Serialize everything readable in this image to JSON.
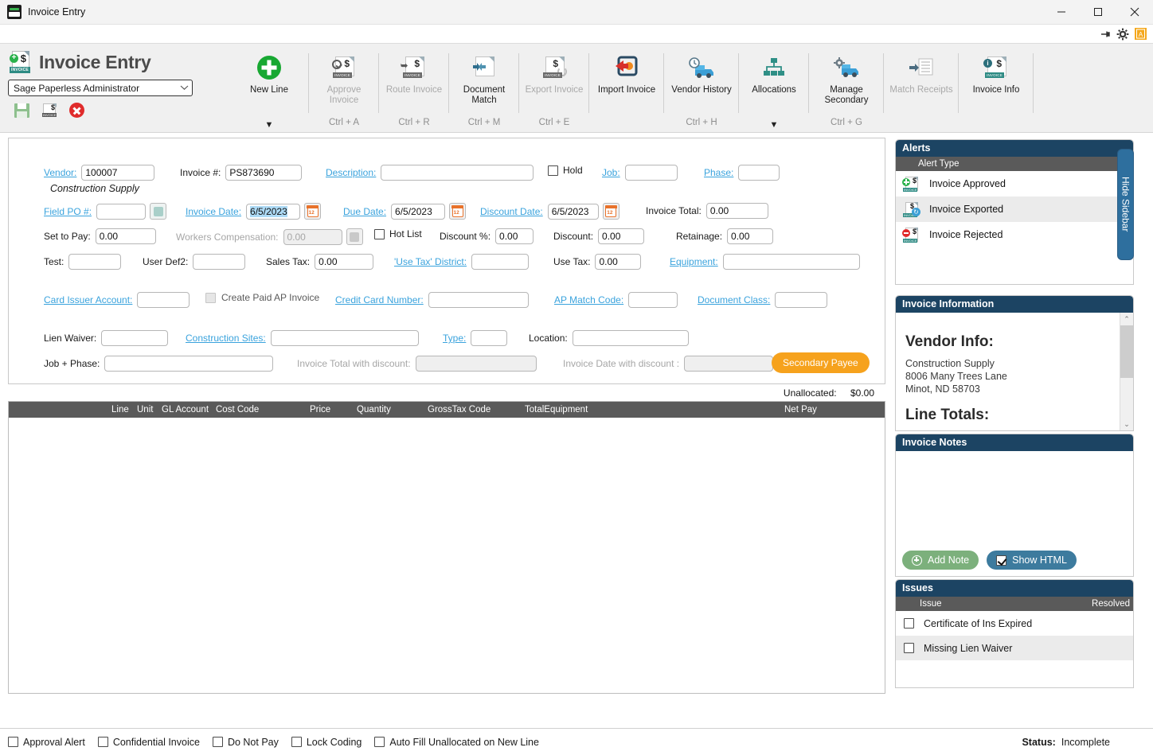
{
  "window": {
    "title": "Invoice Entry",
    "minimize_label": "—",
    "maximize_label": "☐",
    "close_label": "✕"
  },
  "mini_strip": {
    "pin_icon": "pin-icon",
    "gear_icon": "gear-icon",
    "badge_icon": "admin-badge-icon"
  },
  "brand": {
    "title": "Invoice Entry",
    "user_select_value": "Sage Paperless Administrator",
    "chevron": "⌄",
    "save_icon": "save-icon",
    "new_invoice_icon": "new-invoice-icon",
    "delete_icon": "delete-icon"
  },
  "ribbon": {
    "items": [
      {
        "label": "New Line",
        "shortcut": "",
        "arrow": "▼",
        "disabled": false,
        "icon": "plus-circle-icon"
      },
      {
        "label": "Approve\nInvoice",
        "shortcut": "Ctrl + A",
        "arrow": "",
        "disabled": true,
        "icon": "approve-invoice-icon"
      },
      {
        "label": "Route Invoice",
        "shortcut": "Ctrl + R",
        "arrow": "",
        "disabled": true,
        "icon": "route-invoice-icon"
      },
      {
        "label": "Document\nMatch",
        "shortcut": "Ctrl + M",
        "arrow": "",
        "disabled": false,
        "icon": "document-match-icon"
      },
      {
        "label": "Export Invoice",
        "shortcut": "Ctrl + E",
        "arrow": "",
        "disabled": true,
        "icon": "export-invoice-icon"
      },
      {
        "label": "Import Invoice",
        "shortcut": "",
        "arrow": "",
        "disabled": false,
        "icon": "import-invoice-icon"
      },
      {
        "label": "Vendor History",
        "shortcut": "Ctrl + H",
        "arrow": "",
        "disabled": false,
        "icon": "vendor-history-icon"
      },
      {
        "label": "Allocations",
        "shortcut": "",
        "arrow": "▼",
        "disabled": false,
        "icon": "allocations-icon"
      },
      {
        "label": "Manage\nSecondary",
        "shortcut": "Ctrl + G",
        "arrow": "",
        "disabled": false,
        "icon": "manage-secondary-icon"
      },
      {
        "label": "Match Receipts",
        "shortcut": "",
        "arrow": "",
        "disabled": true,
        "icon": "match-receipts-icon"
      },
      {
        "label": "Invoice Info",
        "shortcut": "",
        "arrow": "",
        "disabled": false,
        "icon": "invoice-info-icon"
      }
    ]
  },
  "form": {
    "vendor_label": "Vendor:",
    "vendor_value": "100007",
    "vendor_name": "Construction Supply",
    "invoice_no_label": "Invoice #:",
    "invoice_no_value": "PS873690",
    "description_label": "Description:",
    "description_value": "",
    "hold_label": "Hold",
    "job_label": "Job:",
    "job_value": "",
    "phase_label": "Phase:",
    "phase_value": "",
    "field_po_label": "Field PO #:",
    "field_po_value": "",
    "invoice_date_label": "Invoice Date:",
    "invoice_date_value": "6/5/2023",
    "due_date_label": "Due Date:",
    "due_date_value": "6/5/2023",
    "discount_date_label": "Discount Date:",
    "discount_date_value": "6/5/2023",
    "invoice_total_label": "Invoice Total:",
    "invoice_total_value": "0.00",
    "set_to_pay_label": "Set to Pay:",
    "set_to_pay_value": "0.00",
    "workers_comp_label": "Workers Compensation:",
    "workers_comp_value": "0.00",
    "hot_list_label": "Hot List",
    "discount_pct_label": "Discount %:",
    "discount_pct_value": "0.00",
    "discount_label": "Discount:",
    "discount_value": "0.00",
    "retainage_label": "Retainage:",
    "retainage_value": "0.00",
    "test_label": "Test:",
    "test_value": "",
    "user_def2_label": "User Def2:",
    "user_def2_value": "",
    "sales_tax_label": "Sales Tax:",
    "sales_tax_value": "0.00",
    "use_tax_district_label": "'Use Tax' District:",
    "use_tax_district_value": "",
    "use_tax_label": "Use Tax:",
    "use_tax_value": "0.00",
    "equipment_label": "Equipment:",
    "equipment_value": "",
    "card_issuer_label": "Card Issuer Account:",
    "card_issuer_value": "",
    "create_paid_ap_label": "Create Paid AP Invoice",
    "credit_card_label": "Credit Card Number:",
    "credit_card_value": "",
    "ap_match_label": "AP Match Code:",
    "ap_match_value": "",
    "document_class_label": "Document Class:",
    "document_class_value": "",
    "lien_waiver_label": "Lien Waiver:",
    "lien_waiver_value": "",
    "construction_sites_label": "Construction Sites:",
    "construction_sites_value": "",
    "type_label": "Type:",
    "type_value": "",
    "location_label": "Location:",
    "location_value": "",
    "job_phase_label": "Job + Phase:",
    "job_phase_value": "",
    "invoice_total_discount_label": "Invoice Total with discount:",
    "invoice_total_discount_value": "",
    "invoice_date_discount_label": "Invoice Date with discount :",
    "invoice_date_discount_value": "",
    "secondary_payee_label": "Secondary Payee"
  },
  "unallocated": {
    "label": "Unallocated:",
    "amount": "$0.00"
  },
  "grid": {
    "columns": [
      "Line",
      "Unit",
      "GL Account",
      "Cost Code",
      "Price",
      "Quantity",
      "GrossTax Code",
      "TotalEquipment",
      "Net Pay"
    ],
    "rows": []
  },
  "sidebar": {
    "hide_label": "Hide Sidebar",
    "alerts": {
      "title": "Alerts",
      "column": "Alert Type",
      "rows": [
        {
          "label": "Invoice Approved",
          "icon": "invoice-approved-icon"
        },
        {
          "label": "Invoice Exported",
          "icon": "invoice-exported-icon"
        },
        {
          "label": "Invoice Rejected",
          "icon": "invoice-rejected-icon"
        }
      ]
    },
    "invoice_information": {
      "title": "Invoice Information",
      "vendor_heading": "Vendor Info:",
      "vendor_lines": [
        "Construction Supply",
        "8006 Many Trees Lane",
        "Minot, ND 58703"
      ],
      "line_totals_heading": "Line Totals:",
      "scroll_up": "⌃",
      "scroll_down": "⌄"
    },
    "invoice_notes": {
      "title": "Invoice Notes",
      "body_text": "",
      "add_note_label": "Add Note",
      "show_html_label": "Show HTML",
      "show_html_checked": true
    },
    "issues": {
      "title": "Issues",
      "col_issue": "Issue",
      "col_resolved": "Resolved",
      "rows": [
        {
          "label": "Certificate of Ins Expired",
          "resolved": false
        },
        {
          "label": "Missing Lien Waiver",
          "resolved": false
        }
      ]
    }
  },
  "statusbar": {
    "checkboxes": [
      {
        "label": "Approval Alert",
        "checked": false
      },
      {
        "label": "Confidential Invoice",
        "checked": false
      },
      {
        "label": "Do Not Pay",
        "checked": false
      },
      {
        "label": "Lock Coding",
        "checked": false
      },
      {
        "label": "Auto Fill Unallocated on New Line",
        "checked": false
      }
    ],
    "status_label": "Status:",
    "status_value": "Incomplete"
  },
  "colors": {
    "panel_header": "#1c4463",
    "column_header": "#5a5a5a",
    "accent_orange": "#f6a21d",
    "link_blue": "#3aa3dd",
    "green": "#2bb24c",
    "red": "#e02b2b"
  }
}
